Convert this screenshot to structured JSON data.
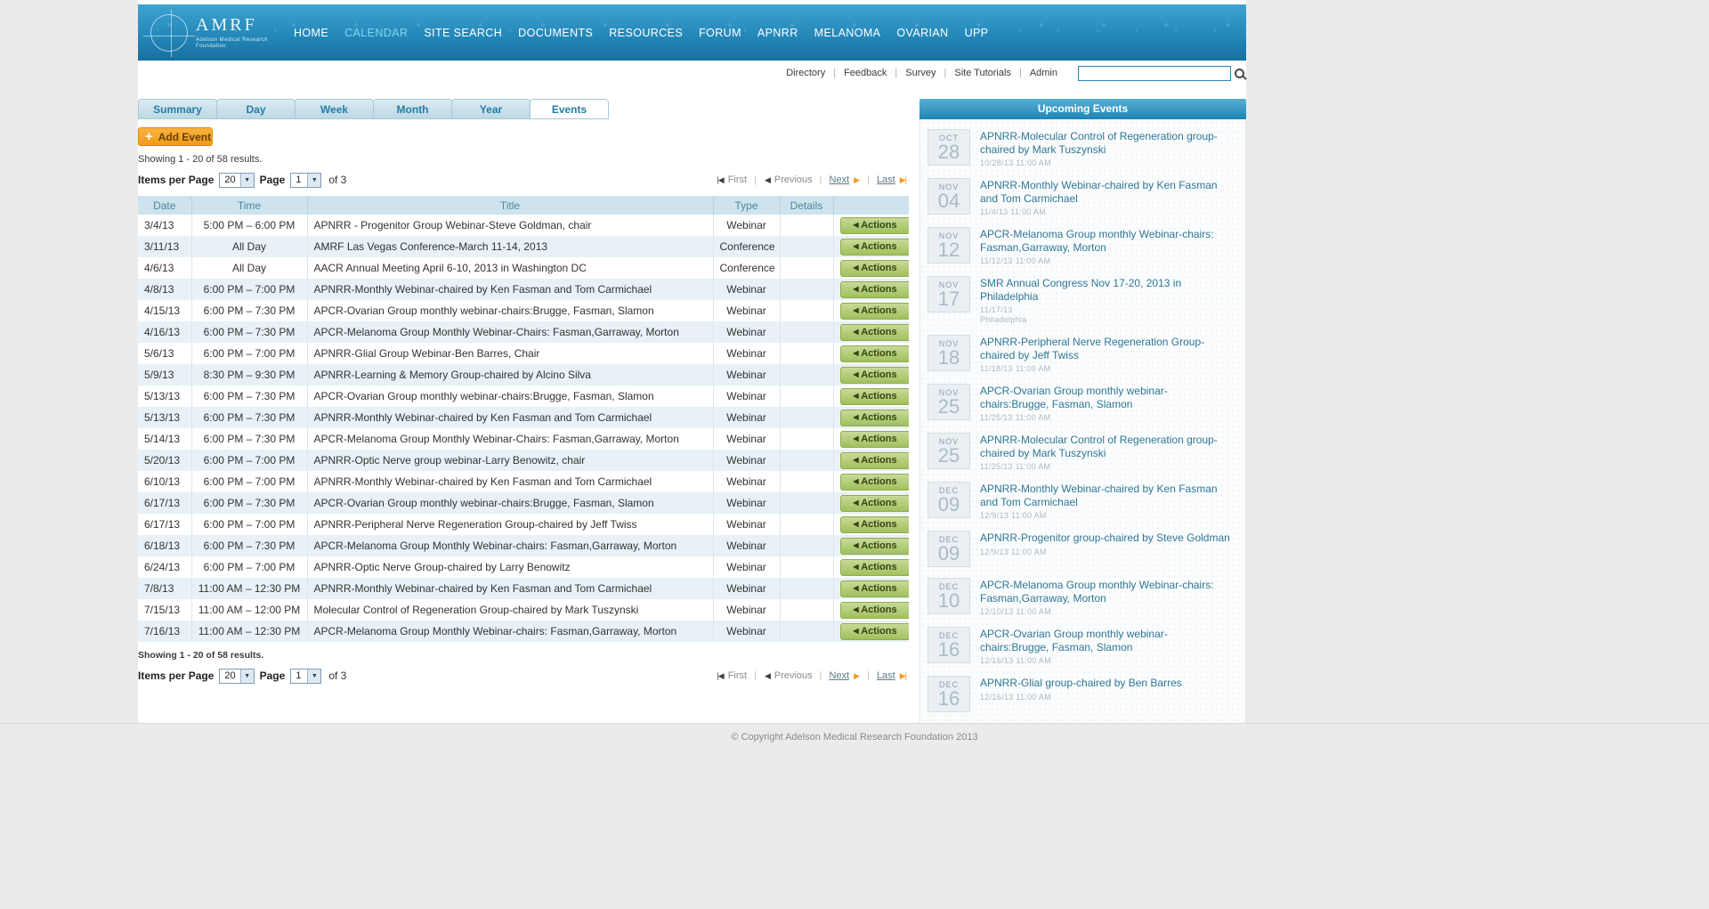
{
  "header": {
    "logo_text": "AMRF",
    "logo_subtext": "Adelson Medical Research Foundation",
    "nav": [
      {
        "label": "HOME",
        "active": false
      },
      {
        "label": "CALENDAR",
        "active": true
      },
      {
        "label": "SITE SEARCH",
        "active": false
      },
      {
        "label": "DOCUMENTS",
        "active": false
      },
      {
        "label": "RESOURCES",
        "active": false
      },
      {
        "label": "FORUM",
        "active": false
      },
      {
        "label": "APNRR",
        "active": false
      },
      {
        "label": "MELANOMA",
        "active": false
      },
      {
        "label": "OVARIAN",
        "active": false
      },
      {
        "label": "UPP",
        "active": false
      }
    ]
  },
  "utility": {
    "links": [
      "Directory",
      "Feedback",
      "Survey",
      "Site Tutorials",
      "Admin"
    ],
    "search_value": "",
    "search_placeholder": ""
  },
  "tabs": [
    {
      "label": "Summary",
      "active": false
    },
    {
      "label": "Day",
      "active": false
    },
    {
      "label": "Week",
      "active": false
    },
    {
      "label": "Month",
      "active": false
    },
    {
      "label": "Year",
      "active": false
    },
    {
      "label": "Events",
      "active": true
    }
  ],
  "toolbar": {
    "add_event_label": "Add Event",
    "plus_glyph": "+"
  },
  "results": {
    "showing": "Showing 1 - 20 of 58 results."
  },
  "pagination": {
    "items_per_page_label": "Items per Page",
    "items_per_page_value": "20",
    "page_label": "Page",
    "page_value": "1",
    "of_label": "of 3",
    "first": "First",
    "previous": "Previous",
    "next": "Next",
    "last": "Last"
  },
  "table": {
    "headers": [
      "Date",
      "Time",
      "Title",
      "Type",
      "Details"
    ],
    "actions_label": "Actions",
    "rows": [
      {
        "date": "3/4/13",
        "time": "5:00 PM – 6:00 PM",
        "title": "APNRR - Progenitor Group Webinar-Steve Goldman, chair",
        "type": "Webinar"
      },
      {
        "date": "3/11/13",
        "time": "All Day",
        "title": "AMRF Las Vegas Conference-March 11-14, 2013",
        "type": "Conference"
      },
      {
        "date": "4/6/13",
        "time": "All Day",
        "title": "AACR Annual Meeting April 6-10, 2013 in Washington DC",
        "type": "Conference"
      },
      {
        "date": "4/8/13",
        "time": "6:00 PM – 7:00 PM",
        "title": "APNRR-Monthly Webinar-chaired by Ken Fasman and Tom Carmichael",
        "type": "Webinar"
      },
      {
        "date": "4/15/13",
        "time": "6:00 PM – 7:30 PM",
        "title": "APCR-Ovarian Group monthly webinar-chairs:Brugge, Fasman, Slamon",
        "type": "Webinar"
      },
      {
        "date": "4/16/13",
        "time": "6:00 PM – 7:30 PM",
        "title": "APCR-Melanoma Group Monthly Webinar-Chairs: Fasman,Garraway, Morton",
        "type": "Webinar"
      },
      {
        "date": "5/6/13",
        "time": "6:00 PM – 7:00 PM",
        "title": "APNRR-Glial Group Webinar-Ben Barres, Chair",
        "type": "Webinar"
      },
      {
        "date": "5/9/13",
        "time": "8:30 PM – 9:30 PM",
        "title": "APNRR-Learning & Memory Group-chaired by Alcino Silva",
        "type": "Webinar"
      },
      {
        "date": "5/13/13",
        "time": "6:00 PM – 7:30 PM",
        "title": "APCR-Ovarian Group monthly webinar-chairs:Brugge, Fasman, Slamon",
        "type": "Webinar"
      },
      {
        "date": "5/13/13",
        "time": "6:00 PM – 7:30 PM",
        "title": "APNRR-Monthly Webinar-chaired by Ken Fasman and Tom Carmichael",
        "type": "Webinar"
      },
      {
        "date": "5/14/13",
        "time": "6:00 PM – 7:30 PM",
        "title": "APCR-Melanoma Group Monthly Webinar-Chairs: Fasman,Garraway, Morton",
        "type": "Webinar"
      },
      {
        "date": "5/20/13",
        "time": "6:00 PM – 7:00 PM",
        "title": "APNRR-Optic Nerve group webinar-Larry Benowitz, chair",
        "type": "Webinar"
      },
      {
        "date": "6/10/13",
        "time": "6:00 PM – 7:00 PM",
        "title": "APNRR-Monthly Webinar-chaired by Ken Fasman and Tom Carmichael",
        "type": "Webinar"
      },
      {
        "date": "6/17/13",
        "time": "6:00 PM – 7:30 PM",
        "title": "APCR-Ovarian Group monthly webinar-chairs:Brugge, Fasman, Slamon",
        "type": "Webinar"
      },
      {
        "date": "6/17/13",
        "time": "6:00 PM – 7:00 PM",
        "title": "APNRR-Peripheral Nerve Regeneration Group-chaired by Jeff Twiss",
        "type": "Webinar"
      },
      {
        "date": "6/18/13",
        "time": "6:00 PM – 7:30 PM",
        "title": "APCR-Melanoma Group Monthly Webinar-chairs: Fasman,Garraway, Morton",
        "type": "Webinar"
      },
      {
        "date": "6/24/13",
        "time": "6:00 PM – 7:00 PM",
        "title": "APNRR-Optic Nerve Group-chaired by Larry Benowitz",
        "type": "Webinar"
      },
      {
        "date": "7/8/13",
        "time": "11:00 AM – 12:30 PM",
        "title": "APNRR-Monthly Webinar-chaired by Ken Fasman and Tom Carmichael",
        "type": "Webinar"
      },
      {
        "date": "7/15/13",
        "time": "11:00 AM – 12:00 PM",
        "title": "Molecular Control of Regeneration Group-chaired by Mark Tuszynski",
        "type": "Webinar"
      },
      {
        "date": "7/16/13",
        "time": "11:00 AM – 12:30 PM",
        "title": "APCR-Melanoma Group Monthly Webinar-chairs: Fasman,Garraway, Morton",
        "type": "Webinar"
      }
    ]
  },
  "sidebar": {
    "title": "Upcoming Events",
    "events": [
      {
        "month": "OCT",
        "day": "28",
        "title": "APNRR-Molecular Control of Regeneration group-chaired by Mark Tuszynski",
        "datetime": "10/28/13 11:00 AM"
      },
      {
        "month": "NOV",
        "day": "04",
        "title": "APNRR-Monthly Webinar-chaired by Ken Fasman and Tom Carmichael",
        "datetime": "11/4/13 11:00 AM"
      },
      {
        "month": "NOV",
        "day": "12",
        "title": "APCR-Melanoma Group monthly Webinar-chairs: Fasman,Garraway, Morton",
        "datetime": "11/12/13 11:00 AM"
      },
      {
        "month": "NOV",
        "day": "17",
        "title": "SMR Annual Congress Nov 17-20, 2013 in Philadelphia",
        "datetime": "11/17/13",
        "location": "Philadelphia"
      },
      {
        "month": "NOV",
        "day": "18",
        "title": "APNRR-Peripheral Nerve Regeneration Group-chaired by Jeff Twiss",
        "datetime": "11/18/13 11:00 AM"
      },
      {
        "month": "NOV",
        "day": "25",
        "title": "APCR-Ovarian Group monthly webinar-chairs:Brugge, Fasman, Slamon",
        "datetime": "11/25/13 11:00 AM"
      },
      {
        "month": "NOV",
        "day": "25",
        "title": "APNRR-Molecular Control of Regeneration group-chaired by Mark Tuszynski",
        "datetime": "11/25/13 11:00 AM"
      },
      {
        "month": "DEC",
        "day": "09",
        "title": "APNRR-Monthly Webinar-chaired by Ken Fasman and Tom Carmichael",
        "datetime": "12/9/13 11:00 AM"
      },
      {
        "month": "DEC",
        "day": "09",
        "title": "APNRR-Progenitor group-chaired by Steve Goldman",
        "datetime": "12/9/13 11:00 AM"
      },
      {
        "month": "DEC",
        "day": "10",
        "title": "APCR-Melanoma Group monthly Webinar-chairs: Fasman,Garraway, Morton",
        "datetime": "12/10/13 11:00 AM"
      },
      {
        "month": "DEC",
        "day": "16",
        "title": "APCR-Ovarian Group monthly webinar-chairs:Brugge, Fasman, Slamon",
        "datetime": "12/16/13 11:00 AM"
      },
      {
        "month": "DEC",
        "day": "16",
        "title": "APNRR-Glial group-chaired by Ben Barres",
        "datetime": "12/16/13 11:00 AM"
      }
    ]
  },
  "footer": {
    "copyright": "© Copyright Adelson Medical Research Foundation 2013"
  }
}
